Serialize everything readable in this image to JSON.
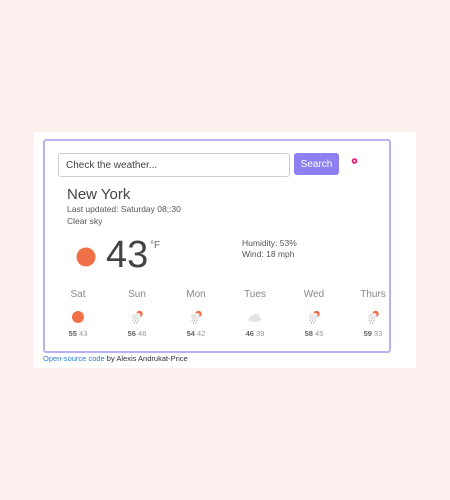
{
  "search": {
    "placeholder": "Check the weather...",
    "button_label": "Search"
  },
  "current": {
    "city": "New York",
    "last_updated": "Last updated: Saturday 08;:30",
    "description": "Clear sky",
    "temperature": "43",
    "unit": "°F",
    "humidity": "Humidity: 53%",
    "wind": "Wind: 18 mph",
    "icon": "sun-icon"
  },
  "forecast": [
    {
      "day": "Sat",
      "max": "55",
      "min": "43",
      "icon": "sun-icon"
    },
    {
      "day": "Sun",
      "max": "56",
      "min": "46",
      "icon": "rain-sun-icon"
    },
    {
      "day": "Mon",
      "max": "54",
      "min": "42",
      "icon": "rain-sun-icon"
    },
    {
      "day": "Tues",
      "max": "46",
      "min": "39",
      "icon": "cloud-icon"
    },
    {
      "day": "Wed",
      "max": "58",
      "min": "45",
      "icon": "rain-sun-icon"
    },
    {
      "day": "Thurs",
      "max": "59",
      "min": "33",
      "icon": "rain-sun-icon"
    }
  ],
  "footer": {
    "link_text": "Open-source code",
    "author_text": " by Alexis Andrukat-Price"
  },
  "colors": {
    "page_background": "#fbf0ee",
    "app_border": "#b8b3f0",
    "search_button": "#8e80f2",
    "sun": "#f07048",
    "location_pin": "#e6207a",
    "link": "#2d7fd1"
  }
}
